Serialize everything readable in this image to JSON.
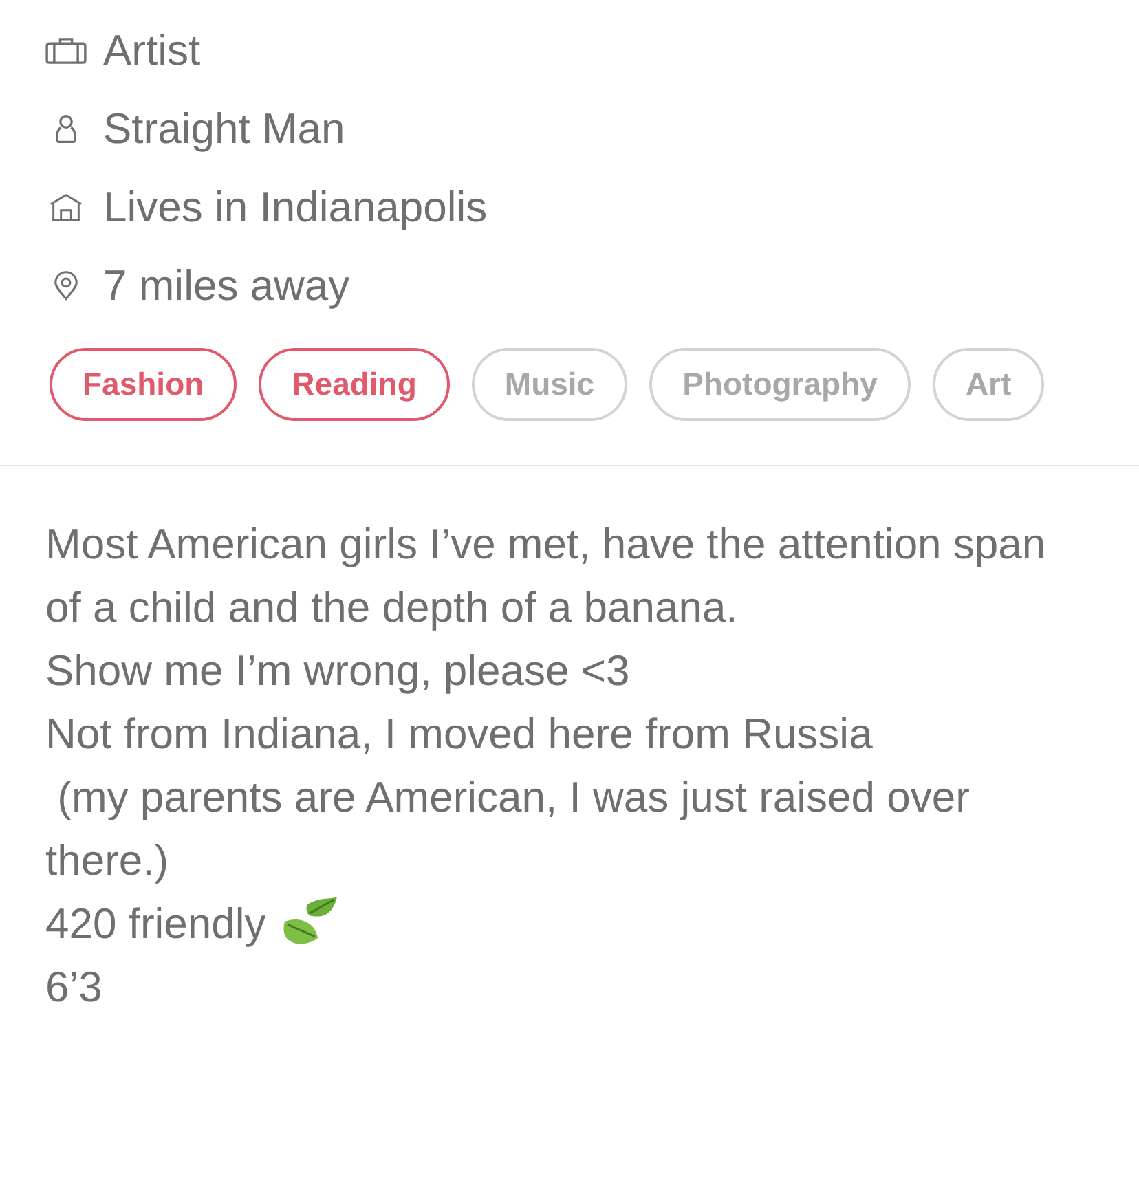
{
  "details": [
    {
      "kind": "job",
      "text": "Artist"
    },
    {
      "kind": "gender",
      "text": "Straight Man"
    },
    {
      "kind": "home",
      "text": "Lives in Indianapolis"
    },
    {
      "kind": "distance",
      "text": "7 miles away"
    }
  ],
  "interests": [
    {
      "label": "Fashion",
      "selected": true
    },
    {
      "label": "Reading",
      "selected": true
    },
    {
      "label": "Music",
      "selected": false
    },
    {
      "label": "Photography",
      "selected": false
    },
    {
      "label": "Art",
      "selected": false
    }
  ],
  "bio": [
    {
      "text": "Most American girls I’ve met, have the attention span of a child and the depth of a banana."
    },
    {
      "text": "Show me I’m wrong, please <3"
    },
    {
      "text": "Not from Indiana, I moved here from Russia"
    },
    {
      "text": " (my parents are American, I was just raised over there.)"
    },
    {
      "text": "420 friendly",
      "kind": "leaf"
    },
    {
      "text": "6’3"
    }
  ]
}
